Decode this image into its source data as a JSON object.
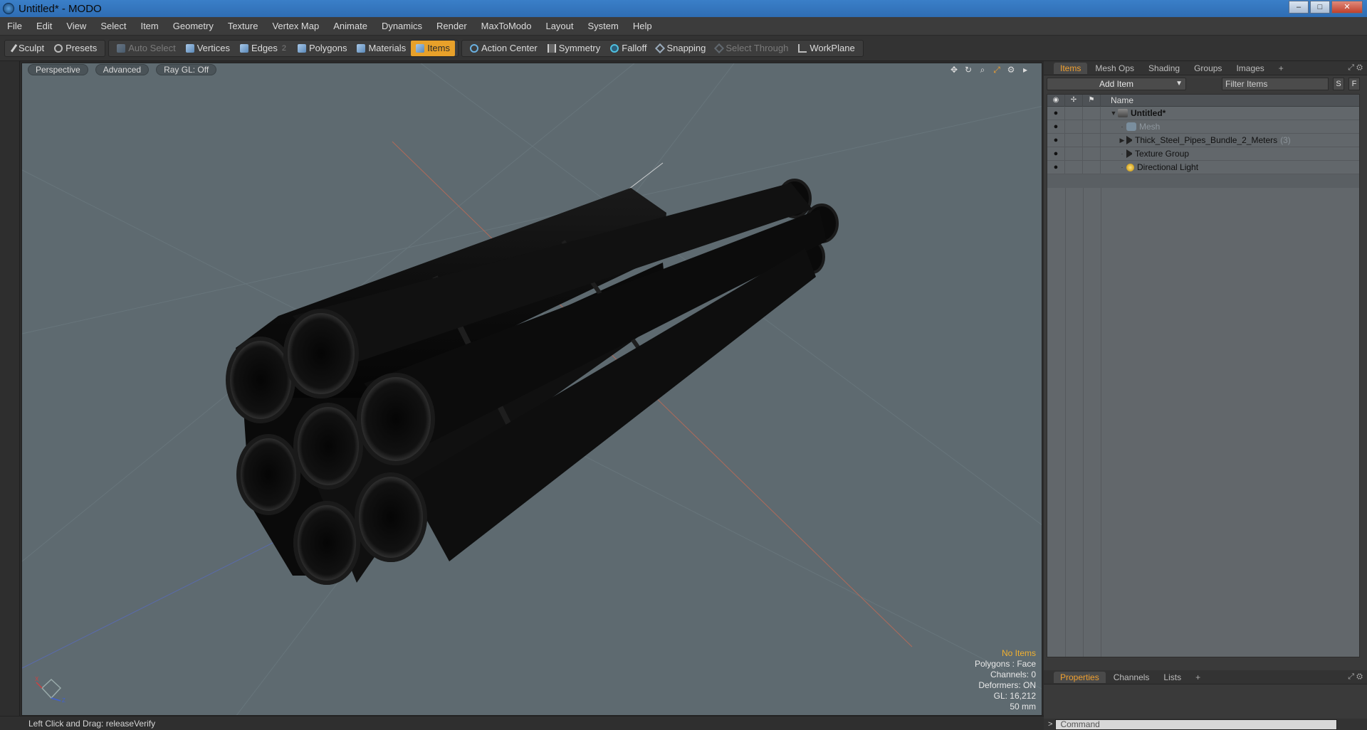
{
  "window": {
    "title": "Untitled* - MODO",
    "min_label": "–",
    "max_label": "□",
    "close_label": "✕"
  },
  "menu": [
    "File",
    "Edit",
    "View",
    "Select",
    "Item",
    "Geometry",
    "Texture",
    "Vertex Map",
    "Animate",
    "Dynamics",
    "Render",
    "MaxToModo",
    "Layout",
    "System",
    "Help"
  ],
  "toolbar": {
    "sculpt": "Sculpt",
    "presets": "Presets",
    "auto_select": "Auto Select",
    "vertices": "Vertices",
    "edges": "Edges",
    "edges_count": "2",
    "polygons": "Polygons",
    "materials": "Materials",
    "items": "Items",
    "action_center": "Action Center",
    "symmetry": "Symmetry",
    "falloff": "Falloff",
    "snapping": "Snapping",
    "select_through": "Select Through",
    "workplane": "WorkPlane"
  },
  "viewport": {
    "view_mode": "Perspective",
    "shading": "Advanced",
    "raygl": "Ray GL: Off",
    "info": {
      "selection": "No Items",
      "polygons": "Polygons : Face",
      "channels": "Channels: 0",
      "deformers": "Deformers: ON",
      "gl": "GL: 16,212",
      "lens": "50 mm"
    },
    "gizmo_axes": [
      "X",
      "Z"
    ]
  },
  "panel": {
    "tabs": [
      "Items",
      "Mesh Ops",
      "Shading",
      "Groups",
      "Images"
    ],
    "add_item": "Add Item",
    "filter_placeholder": "Filter Items",
    "s_btn": "S",
    "f_btn": "F",
    "col_name": "Name",
    "tree": [
      {
        "label": "Untitled*",
        "icon": "scene-icon",
        "bold": true
      },
      {
        "label": "Mesh",
        "icon": "mesh-icon",
        "dim": true
      },
      {
        "label": "Thick_Steel_Pipes_Bundle_2_Meters",
        "icon": "group-icon",
        "count": "(3)"
      },
      {
        "label": "Texture Group",
        "icon": "group-icon"
      },
      {
        "label": "Directional Light",
        "icon": "light-icon"
      }
    ],
    "bottom_tabs": [
      "Properties",
      "Channels",
      "Lists"
    ]
  },
  "status": {
    "hint": "Left Click and Drag:  releaseVerify"
  },
  "command": {
    "prompt": ">",
    "placeholder": "Command"
  },
  "colors": {
    "accent": "#f0a030",
    "viewport_bg": "#5e6a70",
    "title_bar": "#3a7fc8"
  }
}
